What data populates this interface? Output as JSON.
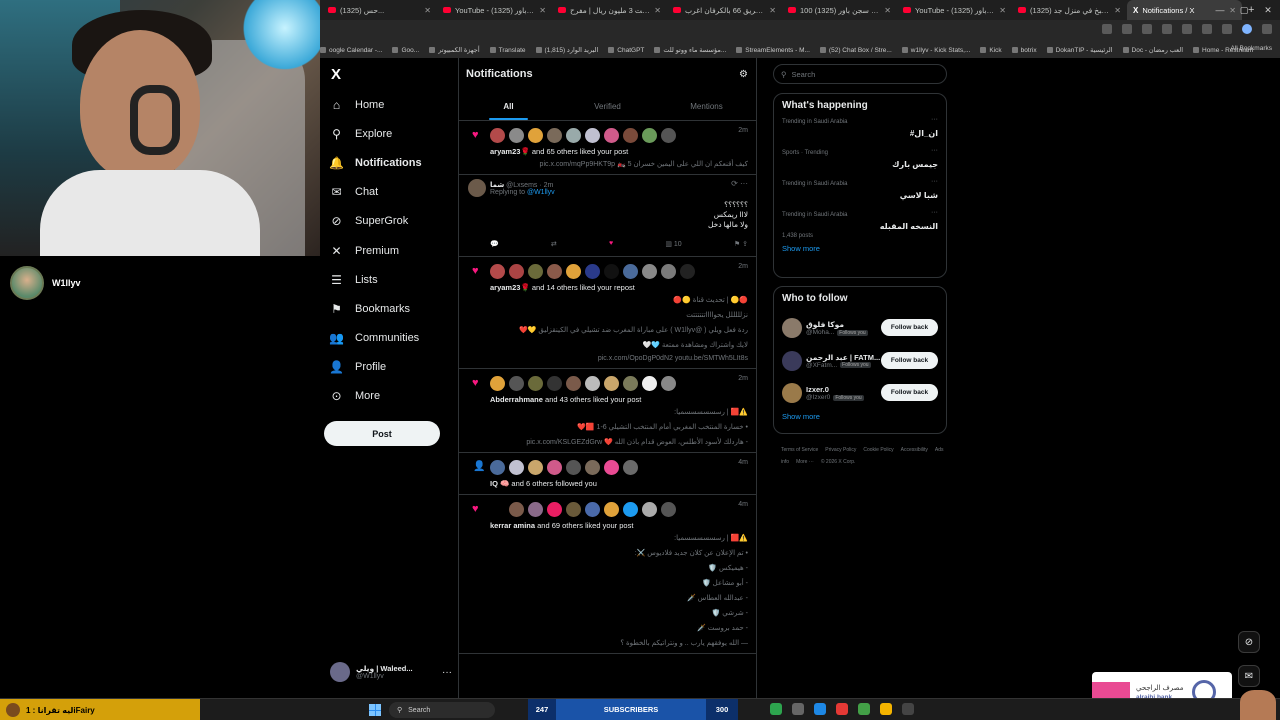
{
  "browser": {
    "tabs": [
      {
        "label": "(1325) حس...",
        "kind": "youtube"
      },
      {
        "label": "YouTube - سجن باور (1325)",
        "kind": "youtube"
      },
      {
        "label": "اسرقت 3 مليون ريال | مفرح...",
        "kind": "youtube"
      },
      {
        "label": "قطعنا طريق 66 بالكرفان اغرب...",
        "kind": "youtube"
      },
      {
        "label": "100 ساعة في سجن باور (1325)",
        "kind": "youtube"
      },
      {
        "label": "YouTube - سجن باور (1325)",
        "kind": "youtube"
      },
      {
        "label": "(1325) فلوق طبخ في منزل جد...",
        "kind": "youtube"
      },
      {
        "label": "Notifications / X",
        "kind": "x",
        "active": true
      }
    ],
    "bookmarks": [
      "oogle Calendar -...",
      "Goo...",
      "أجهزة الكمبيوتر",
      "Translate",
      "البريد الوارد (1,815)",
      "ChatGPT",
      "مؤسسة ماء ووتو للت...",
      "StreamElements - M...",
      "(52) Chat Box / Stre...",
      "w1llyv - Kick Stats,...",
      "Kick",
      "botrix",
      "DokanTIP - الرئيسية",
      "Doc - العب رمضان",
      "Home - Restream"
    ],
    "all_bookmarks": "All Bookmarks"
  },
  "stream": {
    "username": "W1llyv"
  },
  "sidebar": {
    "logo": "X",
    "items": [
      {
        "label": "Home",
        "icon": "home-icon",
        "glyph": "⌂"
      },
      {
        "label": "Explore",
        "icon": "search-icon",
        "glyph": "⚲"
      },
      {
        "label": "Notifications",
        "icon": "bell-icon",
        "glyph": "🔔",
        "active": true
      },
      {
        "label": "Chat",
        "icon": "mail-icon",
        "glyph": "✉"
      },
      {
        "label": "SuperGrok",
        "icon": "grok-icon",
        "glyph": "⊘"
      },
      {
        "label": "Premium",
        "icon": "x-icon",
        "glyph": "✕"
      },
      {
        "label": "Lists",
        "icon": "list-icon",
        "glyph": "☰"
      },
      {
        "label": "Bookmarks",
        "icon": "bookmark-icon",
        "glyph": "⚑"
      },
      {
        "label": "Communities",
        "icon": "people-icon",
        "glyph": "👥"
      },
      {
        "label": "Profile",
        "icon": "person-icon",
        "glyph": "👤"
      },
      {
        "label": "More",
        "icon": "more-icon",
        "glyph": "⊙"
      }
    ],
    "post_label": "Post",
    "account": {
      "name": "ويلي | Waleed...",
      "handle": "@W1llyv"
    }
  },
  "notifications": {
    "title": "Notifications",
    "tabs": [
      "All",
      "Verified",
      "Mentions"
    ],
    "items": [
      {
        "type": "like",
        "time": "2m",
        "actor": "aryam23🌹",
        "text": " and 65 others liked your post",
        "lines": [
          "كيف أقنعكم ان اللي على اليمين خسران 5 🏍️ pic.x.com/mqPp9HKT9p"
        ],
        "avatars": [
          "#b34a4a",
          "#8a8a8a",
          "#e0a23a",
          "#7a6a5a",
          "#9aa",
          "#c0c0d0",
          "#d05a8a",
          "#7a4a3a",
          "#6a9a5a",
          "#555"
        ]
      },
      {
        "type": "reply",
        "name": "شما",
        "handle": "@Lxsems · 2m",
        "replying_prefix": "Replying to ",
        "replying_to": "@W1llyv",
        "body": [
          "؟؟؟؟؟؟",
          "لااا ريمكس",
          "ولا مالها دخل"
        ],
        "views": "10"
      },
      {
        "type": "like",
        "time": "2m",
        "actor": "aryam23🌹",
        "text": " and 14 others liked your repost",
        "lines": [
          "🔴🟡 | تحديث قناة 🟡🔴",
          "نزلللللل يحوااااتتتتتتت",
          "ردة فعل ويلي ( @W1llyv ) على مباراة المغرب ضد تشيلي في الكينقزليق 💛❤️",
          "لايك واشتراك ومشاهدة ممتعة 🩵🤍"
        ],
        "link": "pic.x.com/OpoDgP0dN2 youtu.be/SMTWh5LIt8s",
        "avatars": [
          "#b34a4a",
          "#a44",
          "#6a6a3a",
          "#8a5a4a",
          "#e0a23a",
          "#2a3a8a",
          "#111",
          "#4a6a9a",
          "#888",
          "#7a7a7a",
          "#222"
        ]
      },
      {
        "type": "like",
        "time": "2m",
        "actor": "Abderrahmane",
        "text": " and 43 others liked your post",
        "lines": [
          "⚠️🟥 | رسسسسسسميا:",
          "• خسارة المنتخب المغربي أمام المنتخب التشيلي 6-1 🟥❤️",
          "- هاردلك لأسود الأطلس، العوض قدام باذن الله ❤️ pic.x.com/KSLGEZdGrw"
        ],
        "avatars": [
          "#e0a23a",
          "#555",
          "#6a6a3a",
          "#333",
          "#7a5a4a",
          "#bbb",
          "#c9a66b",
          "#7a7a5a",
          "#eee",
          "#888"
        ]
      },
      {
        "type": "follow",
        "time": "4m",
        "actor": "IQ 🧠",
        "text": " and 6 others followed you",
        "avatars": [
          "#4a6a9a",
          "#c0c0d0",
          "#c9a66b",
          "#d05a8a",
          "#555",
          "#7a6a5a",
          "#e94a93",
          "#6a6a6a"
        ]
      },
      {
        "type": "like",
        "time": "4m",
        "actor": "kerrar amina",
        "text": " and 69 others liked your post",
        "lines": [
          "⚠️🟥 | رسسسسسسميا:",
          "• تم الإعلان عن كلان جديد فلاديوس ⚔️:",
          "- هيميكس 🛡️",
          "- أبو مشاعل 🛡️",
          "- عبدالله العطاس 🗡️",
          "- شرشي 🛡️",
          "- حمد بروست 🗡️",
          "— الله يوفقهم يارب .. و ونتراتيكم بالخطوة ؟"
        ],
        "avatars": [
          "#000",
          "#7a5a4a",
          "#8a6a8a",
          "#e91e63",
          "#6a5a3a",
          "#4a6aaa",
          "#e0a23a",
          "#1d9bf0",
          "#aaa",
          "#555"
        ]
      }
    ]
  },
  "right": {
    "search_placeholder": "Search",
    "happening": {
      "title": "What's happening",
      "trends": [
        {
          "category": "Trending in Saudi Arabia",
          "name": "#ان_ال",
          "count": ""
        },
        {
          "category": "Sports · Trending",
          "name": "جيمس بارك",
          "count": ""
        },
        {
          "category": "Trending in Saudi Arabia",
          "name": "شبا لاسي",
          "count": ""
        },
        {
          "category": "Trending in Saudi Arabia",
          "name": "النسخه المقبله",
          "count": "1,438 posts"
        }
      ],
      "show_more": "Show more"
    },
    "who_to_follow": {
      "title": "Who to follow",
      "users": [
        {
          "name": "موكا فلوق",
          "handle": "@Moha...",
          "badge": "Follows you",
          "button": "Follow back",
          "color": "#8a7a6a"
        },
        {
          "name": "عبد الرحمن | FATM...",
          "handle": "@XFatm...",
          "badge": "Follows you",
          "button": "Follow back",
          "color": "#3a3a5a"
        },
        {
          "name": "Izxer.0",
          "handle": "@Izxer0",
          "badge": "Follows you",
          "button": "Follow back",
          "color": "#9a7a4a"
        }
      ],
      "show_more": "Show more"
    },
    "footer": [
      "Terms of Service",
      "Privacy Policy",
      "Cookie Policy",
      "Accessibility",
      "Ads info",
      "More ···",
      "© 2026 X Corp."
    ]
  },
  "taskbar": {
    "left_text": "ليه تقرانا : 1iFairy",
    "search": "Search",
    "subs_count": "247",
    "subs_label": "SUBSCRIBERS",
    "subs_goal": "300",
    "bank_ar": "مصرف الراجحي",
    "bank_en": "alrajhi bank"
  }
}
